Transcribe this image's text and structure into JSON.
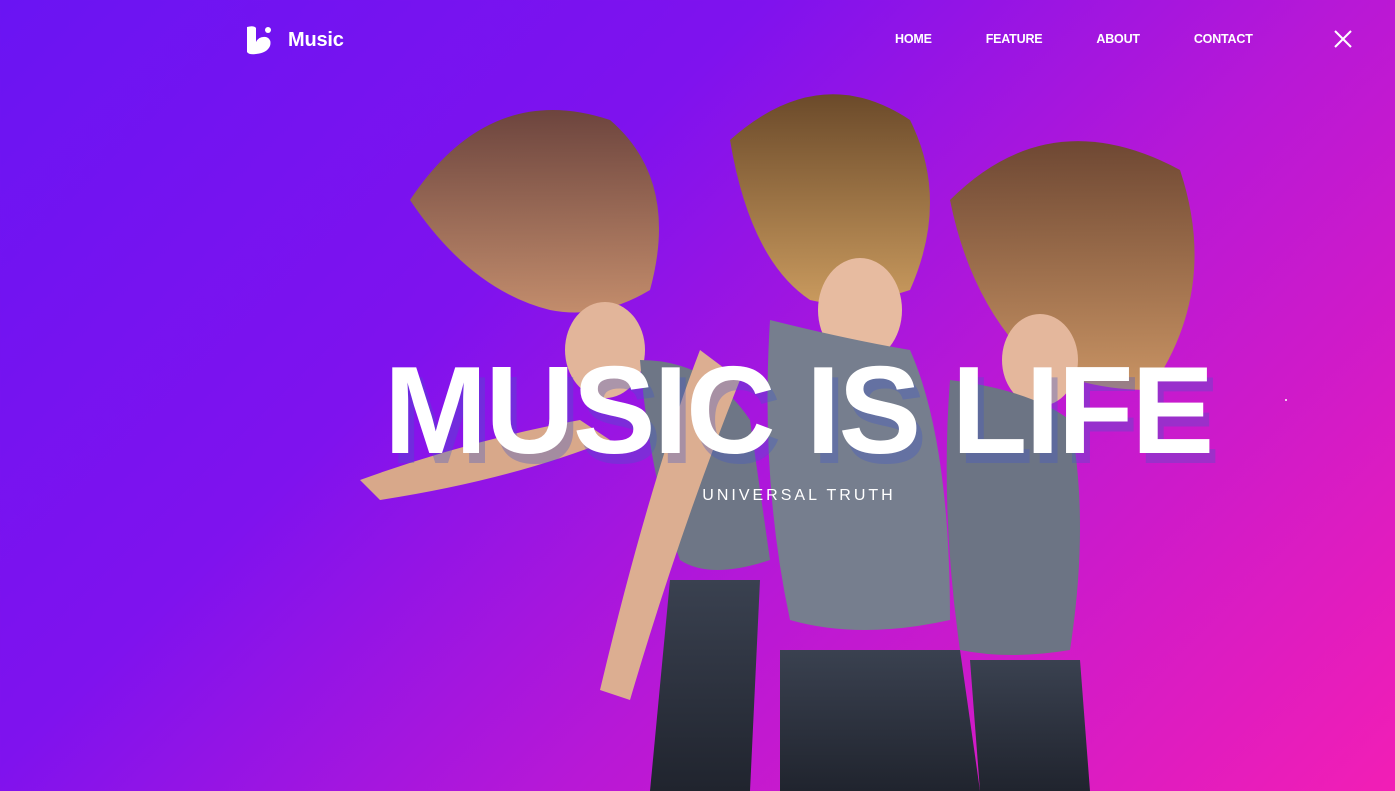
{
  "brand": {
    "name": "Music",
    "logo_icon": "music-logo-icon"
  },
  "nav": {
    "items": [
      {
        "label": "HOME"
      },
      {
        "label": "FEATURE"
      },
      {
        "label": "ABOUT"
      },
      {
        "label": "CONTACT"
      }
    ],
    "close_icon": "close-icon"
  },
  "hero": {
    "headline": "MUSIC IS LIFE",
    "subheadline": "UNIVERSAL TRUTH",
    "image": "dancing-women-photo"
  },
  "colors": {
    "gradient_start": "#6a14f3",
    "gradient_end": "#f21eb5",
    "text": "#ffffff"
  }
}
